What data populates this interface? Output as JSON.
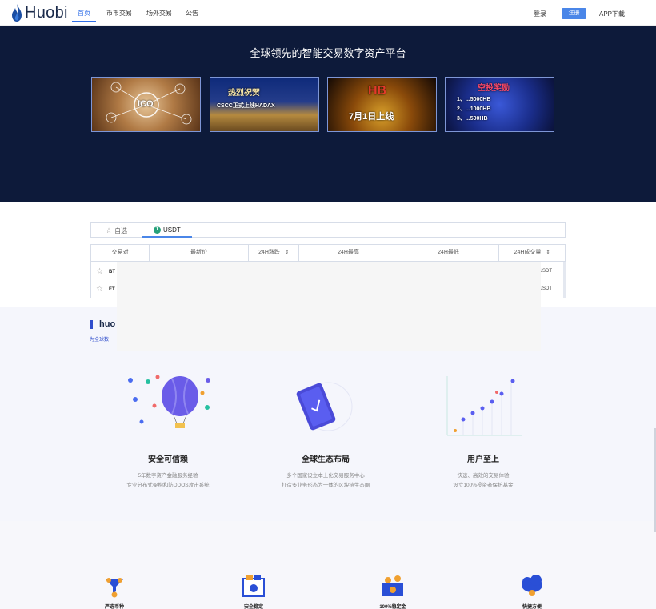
{
  "brand": {
    "name": "Huobi"
  },
  "nav": {
    "items": [
      {
        "label": "首页",
        "active": true
      },
      {
        "label": "币币交易",
        "active": false
      },
      {
        "label": "场外交易",
        "active": false
      },
      {
        "label": "公告",
        "active": false
      }
    ],
    "login": "登录",
    "register": "注册",
    "app": "APP下载"
  },
  "hero": {
    "title": "全球领先的智能交易数字资产平台",
    "banners": [
      {
        "text": "ICO"
      },
      {
        "line1": "热烈祝贺",
        "line2": "CSCC正式上线HADAX"
      },
      {
        "line1": "HB",
        "line2": "7月1日上线"
      },
      {
        "line1": "空投奖励",
        "line2": "1、...5000HB",
        "line3": "2、...1000HB",
        "line4": "3、...500HB"
      }
    ]
  },
  "market": {
    "tabs": [
      {
        "label": "自选",
        "icon": "star-icon"
      },
      {
        "label": "USDT",
        "icon": "usdt-icon"
      }
    ],
    "columns": [
      "交易对",
      "最新价",
      "24H涨跌",
      "24H最高",
      "24H最低",
      "24H成交量"
    ],
    "rows": [
      {
        "symbol": "BT",
        "pair": "USDT"
      },
      {
        "symbol": "ET",
        "pair": "USDT"
      }
    ]
  },
  "features": {
    "section_title": "huo",
    "section_sub": "为全球数",
    "items": [
      {
        "title": "安全可信赖",
        "desc1": "5年数字资产金融服务经验",
        "desc2": "专业分布式架构和防DDOS攻击系统"
      },
      {
        "title": "全球生态布局",
        "desc1": "多个国家设立本土化交易服务中心",
        "desc2": "打造多业务形态为一体的区块链生态圈"
      },
      {
        "title": "用户至上",
        "desc1": "快速、高效的交易体验",
        "desc2": "设立100%投资者保护基金"
      }
    ]
  },
  "bottom": {
    "items": [
      {
        "label": "严选币种"
      },
      {
        "label": "安全稳定"
      },
      {
        "label": "100%稳定金"
      },
      {
        "label": "快捷方便"
      }
    ]
  },
  "colors": {
    "accent": "#2f6ee7",
    "hero_bg": "#0d1a3a",
    "register_bg": "#4a86e8",
    "usdt": "#26a17b"
  }
}
